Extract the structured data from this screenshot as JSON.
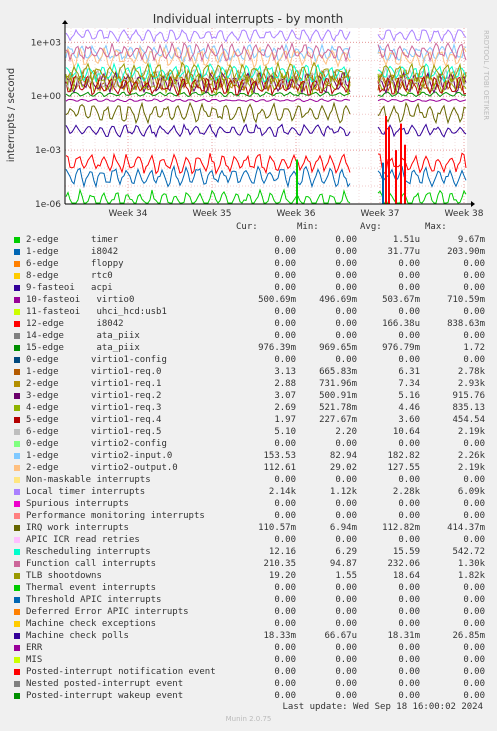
{
  "chart_data": {
    "type": "line",
    "title": "Individual interrupts - by month",
    "ylabel": "interrupts / second",
    "side_label": "RRDTOOL / TOBI OETIKER",
    "y_scale": "log",
    "y_ticks": [
      {
        "label": "1e+03",
        "value": 1000
      },
      {
        "label": "1e+00",
        "value": 1
      },
      {
        "label": "1e-03",
        "value": 0.001
      },
      {
        "label": "1e-06",
        "value": 1e-06
      }
    ],
    "x_ticks": [
      "Week 34",
      "Week 35",
      "Week 36",
      "Week 37",
      "Week 38"
    ],
    "grid": true,
    "series_hint": "daily oscillating traces, data gap late Week 36"
  },
  "legend": {
    "headers": {
      "cur": "Cur:",
      "min": "Min:",
      "avg": "Avg:",
      "max": "Max:"
    },
    "items": [
      {
        "color": "#00cc00",
        "name": "2-edge      timer",
        "cur": "0.00",
        "min": "0.00",
        "avg": "1.51u",
        "max": "9.67m"
      },
      {
        "color": "#0066b3",
        "name": "1-edge      i8042",
        "cur": "0.00",
        "min": "0.00",
        "avg": "31.77u",
        "max": "203.90m"
      },
      {
        "color": "#ff8000",
        "name": "6-edge      floppy",
        "cur": "0.00",
        "min": "0.00",
        "avg": "0.00",
        "max": "0.00"
      },
      {
        "color": "#ffcc00",
        "name": "8-edge      rtc0",
        "cur": "0.00",
        "min": "0.00",
        "avg": "0.00",
        "max": "0.00"
      },
      {
        "color": "#330099",
        "name": "9-fasteoi   acpi",
        "cur": "0.00",
        "min": "0.00",
        "avg": "0.00",
        "max": "0.00"
      },
      {
        "color": "#990099",
        "name": "10-fasteoi   virtio0",
        "cur": "500.69m",
        "min": "496.69m",
        "avg": "503.67m",
        "max": "710.59m"
      },
      {
        "color": "#ccff00",
        "name": "11-fasteoi   uhci_hcd:usb1",
        "cur": "0.00",
        "min": "0.00",
        "avg": "0.00",
        "max": "0.00"
      },
      {
        "color": "#ff0000",
        "name": "12-edge      i8042",
        "cur": "0.00",
        "min": "0.00",
        "avg": "166.38u",
        "max": "838.63m"
      },
      {
        "color": "#808080",
        "name": "14-edge      ata_piix",
        "cur": "0.00",
        "min": "0.00",
        "avg": "0.00",
        "max": "0.00"
      },
      {
        "color": "#008f00",
        "name": "15-edge      ata_piix",
        "cur": "976.39m",
        "min": "969.65m",
        "avg": "976.79m",
        "max": "1.72"
      },
      {
        "color": "#00487d",
        "name": "0-edge      virtio1-config",
        "cur": "0.00",
        "min": "0.00",
        "avg": "0.00",
        "max": "0.00"
      },
      {
        "color": "#b35a00",
        "name": "1-edge      virtio1-req.0",
        "cur": "3.13",
        "min": "665.83m",
        "avg": "6.31",
        "max": "2.78k"
      },
      {
        "color": "#b38f00",
        "name": "2-edge      virtio1-req.1",
        "cur": "2.88",
        "min": "731.96m",
        "avg": "7.34",
        "max": "2.93k"
      },
      {
        "color": "#6b006b",
        "name": "3-edge      virtio1-req.2",
        "cur": "3.07",
        "min": "500.91m",
        "avg": "5.16",
        "max": "915.76"
      },
      {
        "color": "#8fb300",
        "name": "4-edge      virtio1-req.3",
        "cur": "2.69",
        "min": "521.78m",
        "avg": "4.46",
        "max": "835.13"
      },
      {
        "color": "#b30000",
        "name": "5-edge      virtio1-req.4",
        "cur": "1.97",
        "min": "227.67m",
        "avg": "3.60",
        "max": "454.54"
      },
      {
        "color": "#bebebe",
        "name": "6-edge      virtio1-req.5",
        "cur": "5.10",
        "min": "2.20",
        "avg": "10.64",
        "max": "2.19k"
      },
      {
        "color": "#80ff80",
        "name": "0-edge      virtio2-config",
        "cur": "0.00",
        "min": "0.00",
        "avg": "0.00",
        "max": "0.00"
      },
      {
        "color": "#80c9ff",
        "name": "1-edge      virtio2-input.0",
        "cur": "153.53",
        "min": "82.94",
        "avg": "182.82",
        "max": "2.26k"
      },
      {
        "color": "#ffc080",
        "name": "2-edge      virtio2-output.0",
        "cur": "112.61",
        "min": "29.02",
        "avg": "127.55",
        "max": "2.19k"
      },
      {
        "color": "#ffe680",
        "name": "Non-maskable interrupts",
        "cur": "0.00",
        "min": "0.00",
        "avg": "0.00",
        "max": "0.00"
      },
      {
        "color": "#aa80ff",
        "name": "Local timer interrupts",
        "cur": "2.14k",
        "min": "1.12k",
        "avg": "2.28k",
        "max": "6.09k"
      },
      {
        "color": "#ee00cc",
        "name": "Spurious interrupts",
        "cur": "0.00",
        "min": "0.00",
        "avg": "0.00",
        "max": "0.00"
      },
      {
        "color": "#ff8080",
        "name": "Performance monitoring interrupts",
        "cur": "0.00",
        "min": "0.00",
        "avg": "0.00",
        "max": "0.00"
      },
      {
        "color": "#666600",
        "name": "IRQ work interrupts",
        "cur": "110.57m",
        "min": "6.94m",
        "avg": "112.82m",
        "max": "414.37m"
      },
      {
        "color": "#ffbfff",
        "name": "APIC ICR read retries",
        "cur": "0.00",
        "min": "0.00",
        "avg": "0.00",
        "max": "0.00"
      },
      {
        "color": "#00ffcc",
        "name": "Rescheduling interrupts",
        "cur": "12.16",
        "min": "6.29",
        "avg": "15.59",
        "max": "542.72"
      },
      {
        "color": "#cc6699",
        "name": "Function call interrupts",
        "cur": "210.35",
        "min": "94.87",
        "avg": "232.06",
        "max": "1.30k"
      },
      {
        "color": "#999900",
        "name": "TLB shootdowns",
        "cur": "19.20",
        "min": "1.55",
        "avg": "18.64",
        "max": "1.82k"
      },
      {
        "color": "#00cc00",
        "name": "Thermal event interrupts",
        "cur": "0.00",
        "min": "0.00",
        "avg": "0.00",
        "max": "0.00"
      },
      {
        "color": "#0066b3",
        "name": "Threshold APIC interrupts",
        "cur": "0.00",
        "min": "0.00",
        "avg": "0.00",
        "max": "0.00"
      },
      {
        "color": "#ff8000",
        "name": "Deferred Error APIC interrupts",
        "cur": "0.00",
        "min": "0.00",
        "avg": "0.00",
        "max": "0.00"
      },
      {
        "color": "#ffcc00",
        "name": "Machine check exceptions",
        "cur": "0.00",
        "min": "0.00",
        "avg": "0.00",
        "max": "0.00"
      },
      {
        "color": "#330099",
        "name": "Machine check polls",
        "cur": "18.33m",
        "min": "66.67u",
        "avg": "18.31m",
        "max": "26.85m"
      },
      {
        "color": "#990099",
        "name": "ERR",
        "cur": "0.00",
        "min": "0.00",
        "avg": "0.00",
        "max": "0.00"
      },
      {
        "color": "#ccff00",
        "name": "MIS",
        "cur": "0.00",
        "min": "0.00",
        "avg": "0.00",
        "max": "0.00"
      },
      {
        "color": "#ff0000",
        "name": "Posted-interrupt notification event",
        "cur": "0.00",
        "min": "0.00",
        "avg": "0.00",
        "max": "0.00"
      },
      {
        "color": "#808080",
        "name": "Nested posted-interrupt event",
        "cur": "0.00",
        "min": "0.00",
        "avg": "0.00",
        "max": "0.00"
      },
      {
        "color": "#008f00",
        "name": "Posted-interrupt wakeup event",
        "cur": "0.00",
        "min": "0.00",
        "avg": "0.00",
        "max": "0.00"
      }
    ]
  },
  "footer": {
    "last_update": "Last update: Wed Sep 18 16:00:02 2024",
    "munin": "Munin 2.0.75"
  }
}
